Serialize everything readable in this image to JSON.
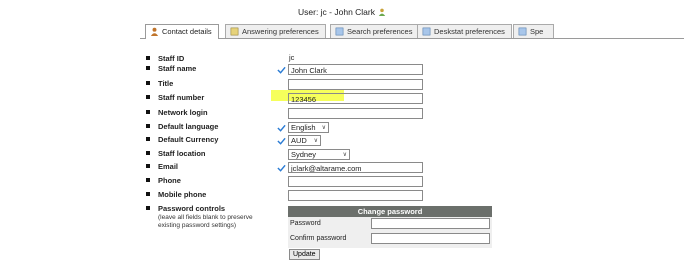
{
  "header": {
    "label": "User: jc - John Clark"
  },
  "tabs": [
    "Contact details",
    "Answering preferences",
    "Search preferences",
    "Deskstat preferences",
    "Spe"
  ],
  "fields": {
    "staff_id": {
      "label": "Staff ID",
      "value": "jc"
    },
    "staff_name": {
      "label": "Staff name",
      "value": "John Clark"
    },
    "title": {
      "label": "Title",
      "value": ""
    },
    "staff_number": {
      "label": "Staff number",
      "value": "123456"
    },
    "network_login": {
      "label": "Network login",
      "value": ""
    },
    "default_language": {
      "label": "Default language",
      "value": "English"
    },
    "default_currency": {
      "label": "Default Currency",
      "value": "AUD"
    },
    "staff_location": {
      "label": "Staff location",
      "value": "Sydney"
    },
    "email": {
      "label": "Email",
      "value": "jclark@altarame.com"
    },
    "phone": {
      "label": "Phone",
      "value": ""
    },
    "mobile_phone": {
      "label": "Mobile phone",
      "value": ""
    }
  },
  "password": {
    "label": "Password controls",
    "note_line1": "(leave all fields blank to preserve",
    "note_line2": "existing password settings)",
    "panel_title": "Change password",
    "password_label": "Password",
    "confirm_label": "Confirm password"
  },
  "update_button": "Update",
  "colors": {
    "check": "#2a7bd4",
    "highlight": "#f6ff52",
    "panel_header": "#6b6f6b"
  }
}
